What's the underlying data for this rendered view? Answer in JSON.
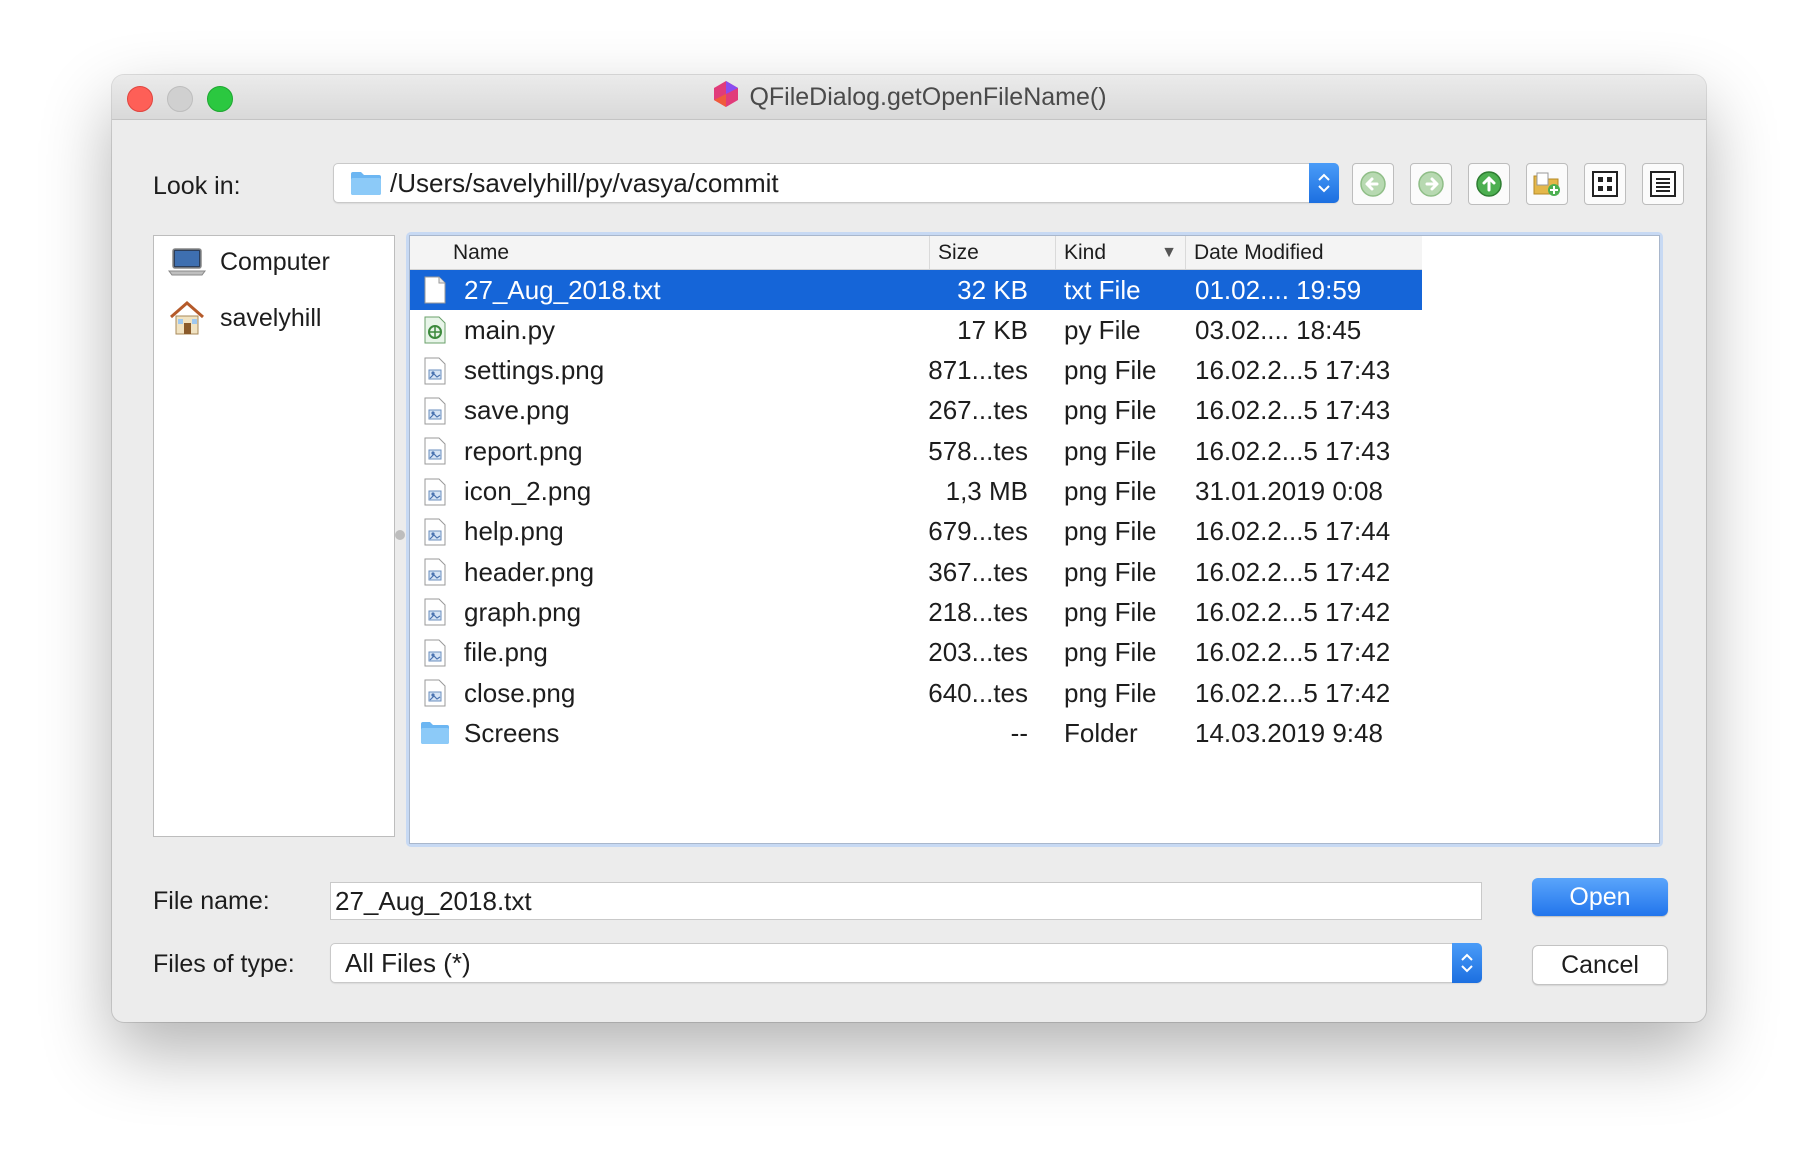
{
  "window": {
    "title": "QFileDialog.getOpenFileName()"
  },
  "look_in": {
    "label": "Look in:",
    "path": "/Users/savelyhill/py/vasya/commit"
  },
  "toolbar": {
    "back_icon": "back-arrow-icon",
    "forward_icon": "forward-arrow-icon",
    "up_icon": "parent-directory-icon",
    "new_folder_icon": "new-folder-icon",
    "list_view_icon": "icon-view-icon",
    "detail_view_icon": "detail-view-icon"
  },
  "sidebar": {
    "items": [
      {
        "label": "Computer",
        "icon": "computer-icon"
      },
      {
        "label": "savelyhill",
        "icon": "home-icon"
      }
    ]
  },
  "columns": {
    "name": "Name",
    "size": "Size",
    "kind": "Kind",
    "sort_indicator": "▼",
    "date": "Date Modified"
  },
  "files": [
    {
      "name": "27_Aug_2018.txt",
      "size": "32 KB",
      "kind": "txt File",
      "date": "01.02.... 19:59",
      "icon": "text-file-icon",
      "selected": true
    },
    {
      "name": "main.py",
      "size": "17 KB",
      "kind": "py File",
      "date": "03.02.... 18:45",
      "icon": "python-file-icon"
    },
    {
      "name": "settings.png",
      "size": "871...tes",
      "kind": "png File",
      "date": "16.02.2...5 17:43",
      "icon": "image-file-icon"
    },
    {
      "name": "save.png",
      "size": "267...tes",
      "kind": "png File",
      "date": "16.02.2...5 17:43",
      "icon": "image-file-icon"
    },
    {
      "name": "report.png",
      "size": "578...tes",
      "kind": "png File",
      "date": "16.02.2...5 17:43",
      "icon": "image-file-icon"
    },
    {
      "name": "icon_2.png",
      "size": "1,3 MB",
      "kind": "png File",
      "date": "31.01.2019 0:08",
      "icon": "image-file-icon"
    },
    {
      "name": "help.png",
      "size": "679...tes",
      "kind": "png File",
      "date": "16.02.2...5 17:44",
      "icon": "image-file-icon"
    },
    {
      "name": "header.png",
      "size": "367...tes",
      "kind": "png File",
      "date": "16.02.2...5 17:42",
      "icon": "image-file-icon"
    },
    {
      "name": "graph.png",
      "size": "218...tes",
      "kind": "png File",
      "date": "16.02.2...5 17:42",
      "icon": "image-file-icon"
    },
    {
      "name": "file.png",
      "size": "203...tes",
      "kind": "png File",
      "date": "16.02.2...5 17:42",
      "icon": "image-file-icon"
    },
    {
      "name": "close.png",
      "size": "640...tes",
      "kind": "png File",
      "date": "16.02.2...5 17:42",
      "icon": "image-file-icon"
    },
    {
      "name": "Screens",
      "size": "--",
      "kind": "Folder",
      "date": "14.03.2019 9:48",
      "icon": "folder-icon"
    }
  ],
  "file_name": {
    "label": "File name:",
    "value": "27_Aug_2018.txt"
  },
  "file_type": {
    "label": "Files of type:",
    "value": "All Files (*)"
  },
  "buttons": {
    "open": "Open",
    "cancel": "Cancel"
  },
  "colors": {
    "accent": "#1565d8",
    "close": "#fe5f57",
    "maximize": "#2bc840",
    "toolbar_icon_green": "#4caf50"
  }
}
